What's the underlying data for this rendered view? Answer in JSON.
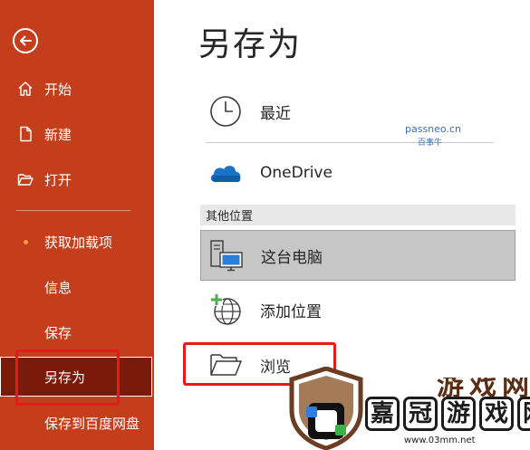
{
  "sidebar": {
    "background": "#c43e1c",
    "selected_background": "#7a1a0b",
    "back_icon": "back-arrow-circle-icon",
    "items": [
      {
        "label": "开始",
        "icon": "home-icon"
      },
      {
        "label": "新建",
        "icon": "new-document-icon"
      },
      {
        "label": "打开",
        "icon": "open-folder-icon"
      },
      {
        "label": "获取加载项",
        "icon": "bullet-dot"
      },
      {
        "label": "信息"
      },
      {
        "label": "保存"
      },
      {
        "label": "另存为",
        "selected": true
      },
      {
        "label": "保存到百度网盘"
      }
    ]
  },
  "main": {
    "title": "另存为",
    "locations": [
      {
        "label": "最近",
        "icon": "clock-icon"
      },
      {
        "label": "OneDrive",
        "icon": "onedrive-cloud-icon"
      }
    ],
    "other_section": {
      "header": "其他位置",
      "items": [
        {
          "label": "这台电脑",
          "icon": "this-pc-icon",
          "selected": true
        },
        {
          "label": "添加位置",
          "icon": "add-place-globe-icon"
        },
        {
          "label": "浏览",
          "icon": "browse-folder-icon"
        }
      ]
    }
  },
  "watermark": {
    "domain": "passneo.cn",
    "name": "百事牛"
  },
  "logo": {
    "ghost_text": "游戏网",
    "chars": [
      "嘉",
      "冠",
      "游",
      "戏",
      "网"
    ],
    "url": "www.03mm.net",
    "highlight_color": "#e8191b"
  }
}
